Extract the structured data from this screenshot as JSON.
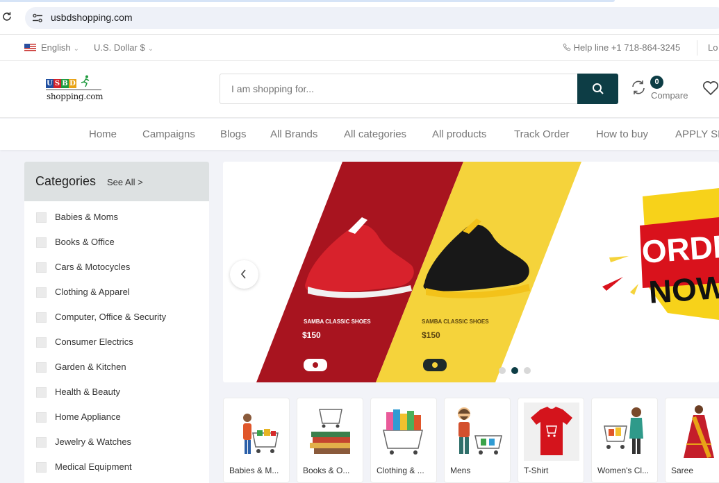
{
  "browser": {
    "url": "usbdshopping.com",
    "icons": [
      "reload-icon",
      "site-settings-icon"
    ]
  },
  "topbar": {
    "language": "English",
    "currency": "U.S. Dollar $",
    "helpline": "Help line +1 718-864-3245",
    "login": "Lo"
  },
  "header": {
    "logo": {
      "letters": [
        "U",
        "S",
        "B",
        "D"
      ],
      "sub": "shopping.com",
      "colors": [
        "#1f4fa0",
        "#d3222a",
        "#1f9a3f",
        "#e8a317"
      ]
    },
    "search_placeholder": "I am shopping for...",
    "compare_count": "0",
    "compare_label": "Compare",
    "accent": "#0d3d45"
  },
  "nav": {
    "items": [
      "Home",
      "Campaigns",
      "Blogs",
      "All Brands",
      "All categories",
      "All products",
      "Track Order",
      "How to buy",
      "APPLY SE"
    ]
  },
  "categories": {
    "title": "Categories",
    "see_all": "See All >",
    "items": [
      "Babies & Moms",
      "Books & Office",
      "Cars & Motocycles",
      "Clothing & Apparel",
      "Computer, Office & Security",
      "Consumer Electrics",
      "Garden & Kitchen",
      "Health & Beauty",
      "Home Appliance",
      "Jewelry & Watches",
      "Medical Equipment"
    ]
  },
  "slider": {
    "slide": {
      "left": {
        "caption": "SAMBA CLASSIC SHOES",
        "price": "$150",
        "color": "#a8141f"
      },
      "right": {
        "caption": "SAMBA CLASSIC SHOES",
        "price": "$150",
        "color": "#f5d33b"
      },
      "promo_top": "ORDE",
      "promo_bottom": "NOW"
    },
    "dots_total": 3,
    "active_dot": 2
  },
  "featured": {
    "items": [
      "Babies & M...",
      "Books & O...",
      "Clothing & ...",
      "Mens",
      "T-Shirt",
      "Women's Cl...",
      "Saree"
    ]
  }
}
